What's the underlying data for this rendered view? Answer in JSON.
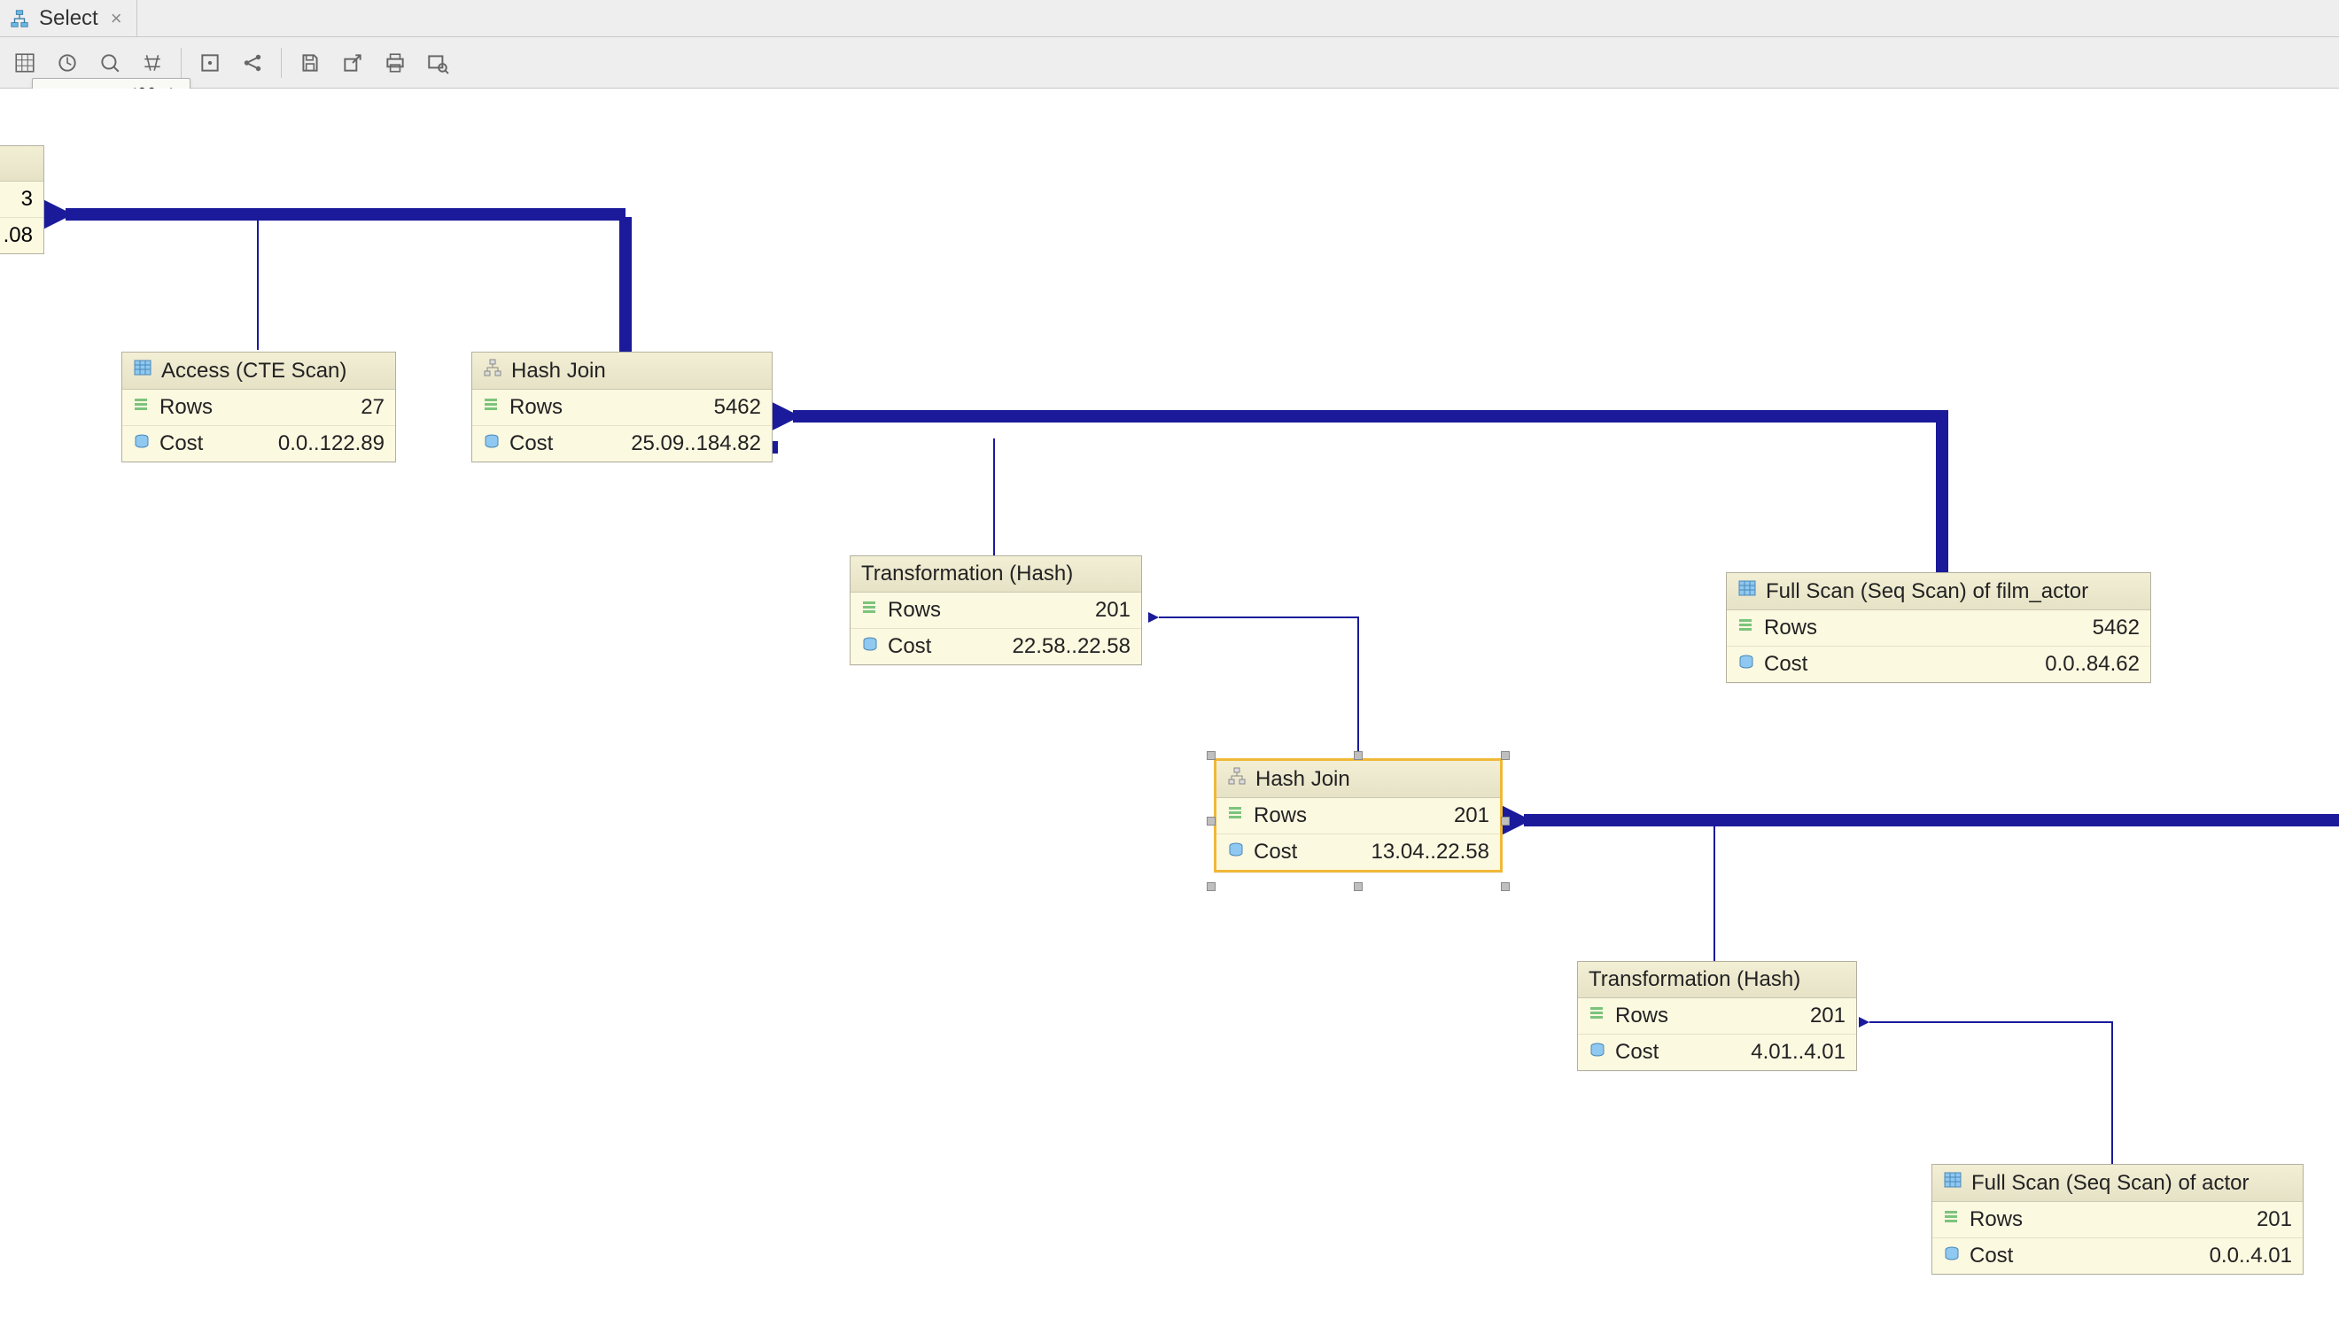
{
  "tab": {
    "label": "Select"
  },
  "tooltip": {
    "text": "Zoom In (⌘+)"
  },
  "toolbar_icons": [
    "select-all-icon",
    "loop-icon",
    "zoom-reset-icon",
    "crosshair-icon",
    "fit-icon",
    "share-icon",
    "save-icon",
    "export-icon",
    "print-icon",
    "inspect-icon"
  ],
  "partial_node": {
    "value1": "3",
    "value2": ".08"
  },
  "nodes": {
    "access_cte": {
      "title": "Access (CTE Scan)",
      "rows_label": "Rows",
      "rows": "27",
      "cost_label": "Cost",
      "cost": "0.0..122.89"
    },
    "hashjoin1": {
      "title": "Hash Join",
      "rows_label": "Rows",
      "rows": "5462",
      "cost_label": "Cost",
      "cost": "25.09..184.82"
    },
    "transform1": {
      "title": "Transformation (Hash)",
      "rows_label": "Rows",
      "rows": "201",
      "cost_label": "Cost",
      "cost": "22.58..22.58"
    },
    "fullscan_fa": {
      "title": "Full Scan (Seq Scan) of film_actor",
      "rows_label": "Rows",
      "rows": "5462",
      "cost_label": "Cost",
      "cost": "0.0..84.62"
    },
    "hashjoin2": {
      "title": "Hash Join",
      "rows_label": "Rows",
      "rows": "201",
      "cost_label": "Cost",
      "cost": "13.04..22.58"
    },
    "transform2": {
      "title": "Transformation (Hash)",
      "rows_label": "Rows",
      "rows": "201",
      "cost_label": "Cost",
      "cost": "4.01..4.01"
    },
    "fullscan_actor": {
      "title": "Full Scan (Seq Scan) of actor",
      "rows_label": "Rows",
      "rows": "201",
      "cost_label": "Cost",
      "cost": "0.0..4.01"
    }
  }
}
